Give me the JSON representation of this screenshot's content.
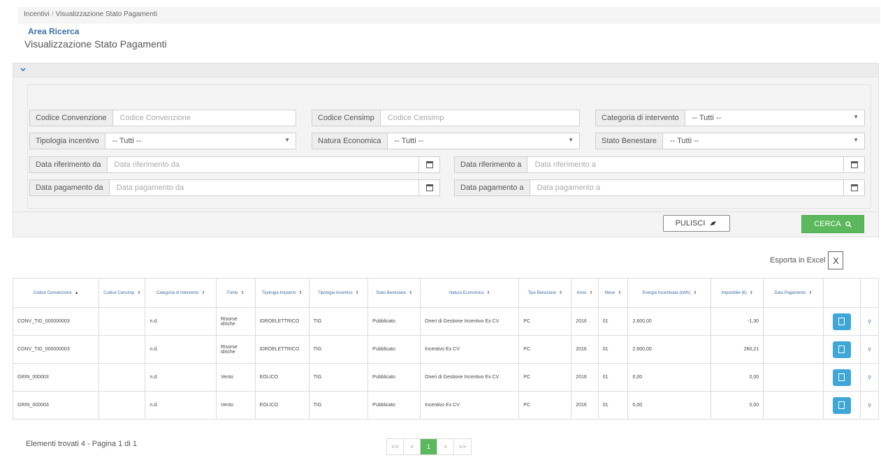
{
  "breadcrumb": {
    "root": "Incentivi",
    "separator": "/",
    "current": "Visualizzazione Stato Pagamenti"
  },
  "page_title": "Visualizzazione Stato Pagamenti",
  "search": {
    "legend": "Area Ricerca",
    "codice_convenzione": {
      "label": "Codice Convenzione",
      "placeholder": "Codice Convenzione"
    },
    "codice_censimp": {
      "label": "Codice Censimp",
      "placeholder": "Codice Censimp"
    },
    "categoria": {
      "label": "Categoria di intervento",
      "value": "-- Tutti --"
    },
    "tipologia": {
      "label": "Tipologia incentivo",
      "value": "-- Tutti --"
    },
    "natura": {
      "label": "Natura Economica",
      "value": "-- Tutti --"
    },
    "stato": {
      "label": "Stato Benestare",
      "value": "-- Tutti --"
    },
    "data_rif_da": {
      "label": "Data riferimento da",
      "placeholder": "Data riferimento da"
    },
    "data_rif_a": {
      "label": "Data riferimento a",
      "placeholder": "Data riferimento a"
    },
    "data_pag_da": {
      "label": "Data pagamento da",
      "placeholder": "Data pagamento da"
    },
    "data_pag_a": {
      "label": "Data pagamento a",
      "placeholder": "Data pagamento a"
    },
    "pulisci_label": "PULISCI",
    "cerca_label": "CERCA"
  },
  "export_label": "Esporta in Excel",
  "table": {
    "columns": [
      "Codice Convenzione",
      "Codice Censimp",
      "Categoria di intervento",
      "Fonte",
      "Tipologia Impianto",
      "Tipologia incentivo",
      "Stato Benestare",
      "Natura Economica",
      "Tipo Benestare",
      "Anno",
      "Mese",
      "Energia Incentivata (kWh)",
      "Imponibile (€)",
      "Data Pagamento"
    ],
    "rows": [
      [
        "CONV_TIG_000000003",
        "",
        "n.d.",
        "Risorse idriche",
        "IDROELETTRICO",
        "TIG",
        "Pubblicato",
        "Oneri di Gestione Incentivo Ex CV",
        "PC",
        "2016",
        "01",
        "2.600,00",
        "-1,30",
        ""
      ],
      [
        "CONV_TIG_000000003",
        "",
        "n.d.",
        "Risorse idriche",
        "IDROELETTRICO",
        "TIG",
        "Pubblicato",
        "Incentivo Ex CV",
        "PC",
        "2016",
        "01",
        "2.600,00",
        "260,21",
        ""
      ],
      [
        "GRIN_000003",
        "",
        "n.d.",
        "Vento",
        "EOLICO",
        "TIG",
        "Pubblicato",
        "Oneri di Gestione Incentivo Ex CV",
        "PC",
        "2016",
        "01",
        "0,00",
        "0,00",
        ""
      ],
      [
        "GRIN_000003",
        "",
        "n.d.",
        "Vento",
        "EOLICO",
        "TIG",
        "Pubblicato",
        "Incentivo Ex CV",
        "PC",
        "2016",
        "01",
        "0,00",
        "0,00",
        ""
      ]
    ]
  },
  "footer_text": "Elementi trovati 4 - Pagina 1 di 1",
  "pagination": {
    "first": "<<",
    "prev": "<",
    "current": "1",
    "next": ">",
    "last": ">>"
  }
}
